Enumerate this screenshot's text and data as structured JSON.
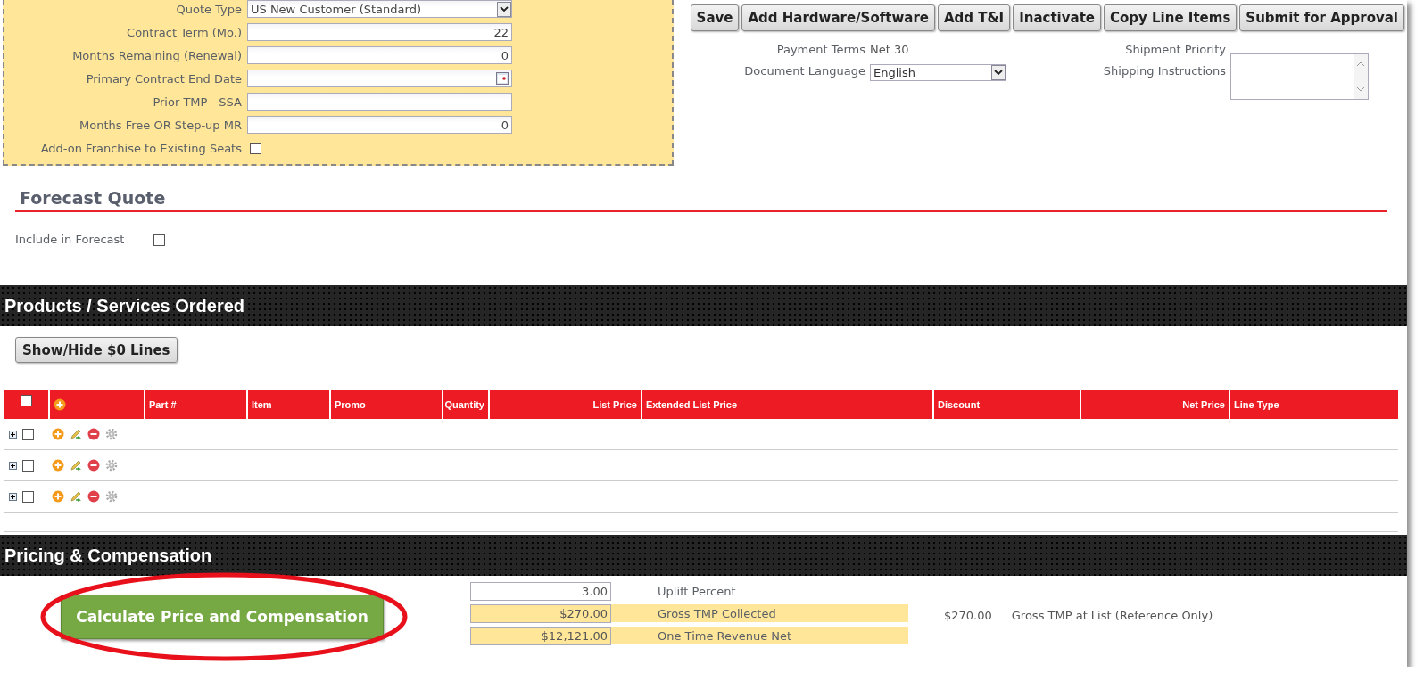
{
  "toolbar": {
    "buttons": [
      "Save",
      "Add Hardware/Software",
      "Add T&I",
      "Inactivate",
      "Copy Line Items",
      "Submit for Approval"
    ]
  },
  "quote_form": {
    "fields": [
      {
        "kind": "select",
        "label": "Quote Type",
        "value": "US New Customer (Standard)"
      },
      {
        "kind": "input",
        "label": "Contract Term (Mo.)",
        "value": "22"
      },
      {
        "kind": "input",
        "label": "Months Remaining (Renewal)",
        "value": "0"
      },
      {
        "kind": "date",
        "label": "Primary Contract End Date"
      },
      {
        "kind": "input",
        "label": "Prior TMP - SSA"
      },
      {
        "kind": "input",
        "label": "Months Free OR Step-up MR",
        "value": "0"
      },
      {
        "kind": "checkbox",
        "label": "Add-on Franchise to Existing Seats",
        "checked": false
      }
    ]
  },
  "terms": [
    {
      "kind": "text",
      "label": "Payment Terms",
      "value": "Net 30"
    },
    {
      "kind": "select",
      "label": "Document Language",
      "value": "English"
    }
  ],
  "shipping": [
    {
      "kind": "text",
      "label": "Shipment Priority"
    },
    {
      "kind": "textarea",
      "label": "Shipping Instructions"
    }
  ],
  "forecast": {
    "title": "Forecast Quote",
    "include": {
      "label": "Include in Forecast",
      "checked": false
    }
  },
  "products": {
    "title": "Products / Services Ordered",
    "toggle_button": "Show/Hide $0 Lines",
    "table": {
      "columns": [
        {
          "kind": "checkbox",
          "checked": false
        },
        {
          "kind": "add"
        },
        {
          "kind": "text",
          "label": "Part #"
        },
        {
          "kind": "text",
          "label": "Item"
        },
        {
          "kind": "text",
          "label": "Promo"
        },
        {
          "kind": "text",
          "label": "Quantity"
        },
        {
          "kind": "text",
          "label": "List Price"
        },
        {
          "kind": "text",
          "label": "Extended List Price"
        },
        {
          "kind": "text",
          "label": "Discount"
        },
        {
          "kind": "text",
          "label": "Net Price"
        },
        {
          "kind": "text",
          "label": "Line Type"
        }
      ],
      "rows": [
        {
          "selected": false
        },
        {
          "selected": false
        },
        {
          "selected": false
        }
      ]
    }
  },
  "pricing": {
    "title": "Pricing & Compensation",
    "button": "Calculate Price and Compensation",
    "fields": [
      {
        "value": "3.00",
        "label": "Uplift Percent",
        "highlighted": false
      },
      {
        "value": "$270.00",
        "label": "Gross TMP Collected",
        "highlighted": true
      },
      {
        "value": "$12,121.00",
        "label": "One Time Revenue Net",
        "highlighted": true
      }
    ],
    "reference": {
      "value": "$270.00",
      "label": "Gross TMP at List (Reference Only)"
    }
  }
}
